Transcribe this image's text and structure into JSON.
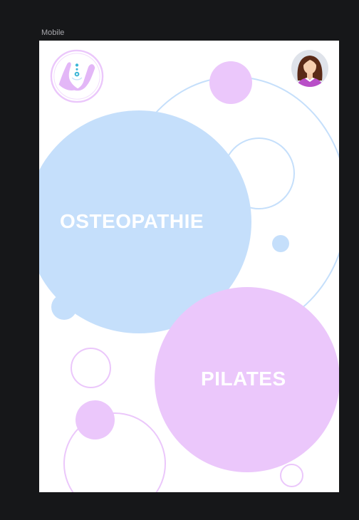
{
  "canvas": {
    "frame_label": "Mobile"
  },
  "app": {
    "logo_icon": "hands-chakra-logo-icon",
    "avatar_icon": "female-avatar-icon"
  },
  "sections": {
    "osteopathie_label": "OSTEOPATHIE",
    "pilates_label": "PILATES"
  },
  "colors": {
    "blue": "#c5dffb",
    "pink": "#ebc7fb",
    "logo_accent": "#3ab6d6"
  }
}
